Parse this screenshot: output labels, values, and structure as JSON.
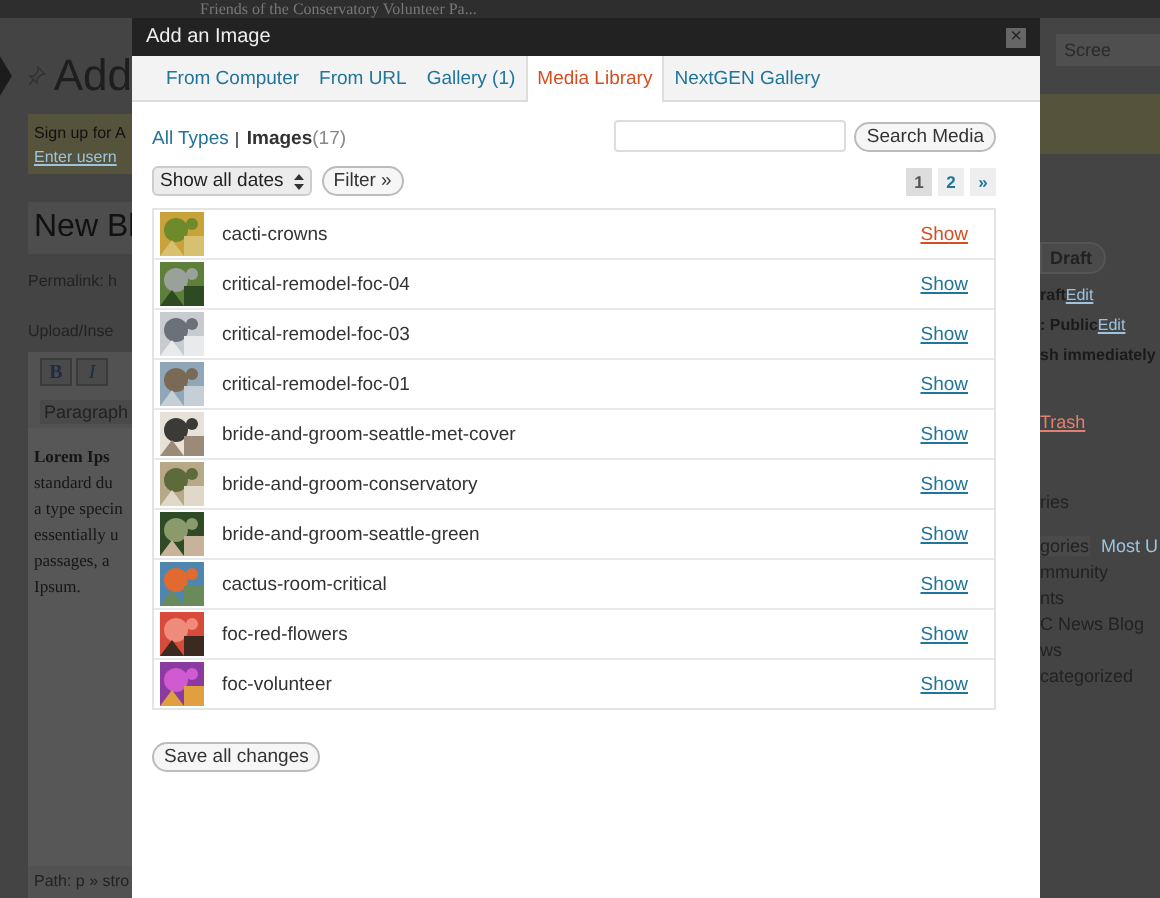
{
  "background_page": {
    "site_title": "Friends of the Conservatory Volunteer Pa...",
    "heading": "Add",
    "notice_lines": [
      "Sign up for A",
      "Enter usern"
    ],
    "post_title": "New Bl",
    "permalink": "Permalink: h",
    "upload_label": "Upload/Inse",
    "toolbar_buttons": [
      "B",
      "I"
    ],
    "format_select": "Paragraph",
    "editor_lines": [
      "Lorem Ips",
      "standard du",
      "a type specin",
      "essentially u",
      "passages, a",
      "Ipsum."
    ],
    "path": "Path: p » stro",
    "screen_options": "Scree",
    "draft_button": "Draft",
    "status_rows": [
      {
        "text": "raft",
        "link": "Edit"
      },
      {
        "text": ": Public",
        "link": "Edit"
      },
      {
        "text": "sh immediately"
      }
    ],
    "trash_link": "Trash",
    "categories_title": "ries",
    "category_tabs": [
      "gories",
      "Most U"
    ],
    "categories": [
      "mmunity",
      "nts",
      "C News Blog",
      "ws",
      "categorized"
    ]
  },
  "dialog": {
    "title": "Add an Image",
    "close": "×",
    "tabs": [
      {
        "label": "From Computer",
        "selected": false
      },
      {
        "label": "From URL",
        "selected": false
      },
      {
        "label": "Gallery (1)",
        "selected": false
      },
      {
        "label": "Media Library",
        "selected": true
      },
      {
        "label": "NextGEN Gallery",
        "selected": false
      }
    ],
    "type_filters": [
      {
        "label": "All Types",
        "selected": false
      },
      {
        "label": "Images",
        "count": "(17)",
        "selected": true
      }
    ],
    "search_button": "Search Media",
    "date_select": "Show all dates",
    "filter_button": "Filter »",
    "pages": [
      {
        "label": "1",
        "selected": true
      },
      {
        "label": "2",
        "selected": false
      },
      {
        "label": "»",
        "selected": false
      }
    ],
    "items": [
      {
        "name": "cacti-crowns",
        "action": "Show",
        "highlighted": true
      },
      {
        "name": "critical-remodel-foc-04",
        "action": "Show",
        "highlighted": false
      },
      {
        "name": "critical-remodel-foc-03",
        "action": "Show",
        "highlighted": false
      },
      {
        "name": "critical-remodel-foc-01",
        "action": "Show",
        "highlighted": false
      },
      {
        "name": "bride-and-groom-seattle-met-cover",
        "action": "Show",
        "highlighted": false
      },
      {
        "name": "bride-and-groom-conservatory",
        "action": "Show",
        "highlighted": false
      },
      {
        "name": "bride-and-groom-seattle-green",
        "action": "Show",
        "highlighted": false
      },
      {
        "name": "cactus-room-critical",
        "action": "Show",
        "highlighted": false
      },
      {
        "name": "foc-red-flowers",
        "action": "Show",
        "highlighted": false
      },
      {
        "name": "foc-volunteer",
        "action": "Show",
        "highlighted": false
      }
    ],
    "save_button": "Save all changes"
  }
}
